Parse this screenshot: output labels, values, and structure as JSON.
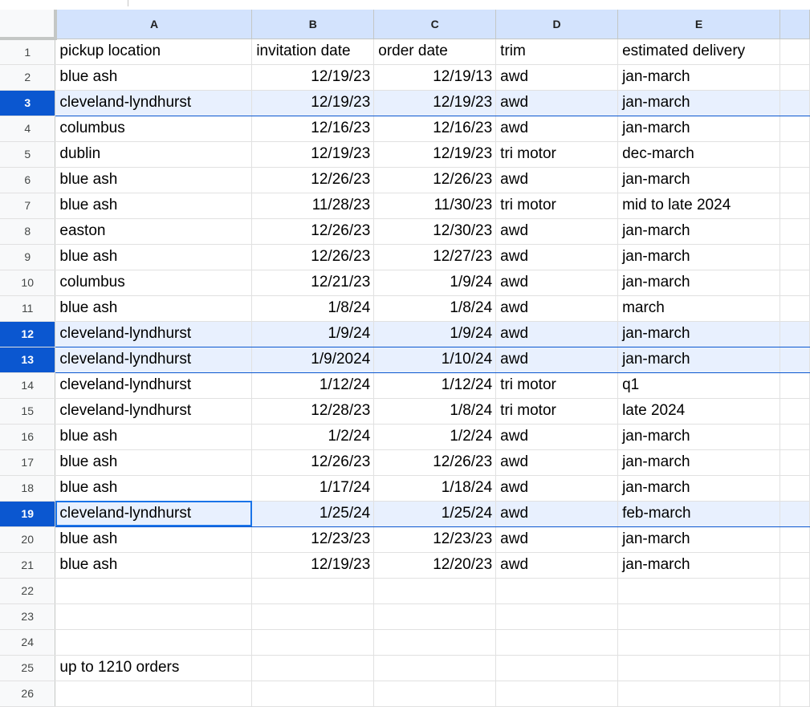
{
  "columns": [
    "A",
    "B",
    "C",
    "D",
    "E"
  ],
  "rows": [
    {
      "n": "1",
      "cells": [
        "pickup location",
        "invitation date",
        "order date",
        "trim",
        "estimated delivery"
      ]
    },
    {
      "n": "2",
      "cells": [
        "blue ash",
        "12/19/23",
        "12/19/13",
        "awd",
        "jan-march"
      ]
    },
    {
      "n": "3",
      "cells": [
        "cleveland-lyndhurst",
        "12/19/23",
        "12/19/23",
        "awd",
        "jan-march"
      ]
    },
    {
      "n": "4",
      "cells": [
        "columbus",
        "12/16/23",
        "12/16/23",
        "awd",
        "jan-march"
      ]
    },
    {
      "n": "5",
      "cells": [
        "dublin",
        "12/19/23",
        "12/19/23",
        "tri motor",
        "dec-march"
      ]
    },
    {
      "n": "6",
      "cells": [
        "blue ash",
        "12/26/23",
        "12/26/23",
        "awd",
        "jan-march"
      ]
    },
    {
      "n": "7",
      "cells": [
        "blue ash",
        "11/28/23",
        "11/30/23",
        "tri motor",
        "mid to late 2024"
      ]
    },
    {
      "n": "8",
      "cells": [
        "easton",
        "12/26/23",
        "12/30/23",
        "awd",
        "jan-march"
      ]
    },
    {
      "n": "9",
      "cells": [
        "blue ash",
        "12/26/23",
        "12/27/23",
        "awd",
        "jan-march"
      ]
    },
    {
      "n": "10",
      "cells": [
        "columbus",
        "12/21/23",
        "1/9/24",
        "awd",
        "jan-march"
      ]
    },
    {
      "n": "11",
      "cells": [
        "blue ash",
        "1/8/24",
        "1/8/24",
        "awd",
        "march"
      ]
    },
    {
      "n": "12",
      "cells": [
        "cleveland-lyndhurst",
        "1/9/24",
        "1/9/24",
        "awd",
        "jan-march"
      ]
    },
    {
      "n": "13",
      "cells": [
        "cleveland-lyndhurst",
        "1/9/2024",
        "1/10/24",
        "awd",
        "jan-march"
      ]
    },
    {
      "n": "14",
      "cells": [
        "cleveland-lyndhurst",
        "1/12/24",
        "1/12/24",
        "tri motor",
        "q1"
      ]
    },
    {
      "n": "15",
      "cells": [
        "cleveland-lyndhurst",
        "12/28/23",
        "1/8/24",
        "tri motor",
        "late 2024"
      ]
    },
    {
      "n": "16",
      "cells": [
        "blue ash",
        "1/2/24",
        "1/2/24",
        "awd",
        "jan-march"
      ]
    },
    {
      "n": "17",
      "cells": [
        "blue ash",
        "12/26/23",
        "12/26/23",
        "awd",
        "jan-march"
      ]
    },
    {
      "n": "18",
      "cells": [
        "blue ash",
        "1/17/24",
        "1/18/24",
        "awd",
        "jan-march"
      ]
    },
    {
      "n": "19",
      "cells": [
        "cleveland-lyndhurst",
        "1/25/24",
        "1/25/24",
        "awd",
        "feb-march"
      ]
    },
    {
      "n": "20",
      "cells": [
        "blue ash",
        "12/23/23",
        "12/23/23",
        "awd",
        "jan-march"
      ]
    },
    {
      "n": "21",
      "cells": [
        "blue ash",
        "12/19/23",
        "12/20/23",
        "awd",
        "jan-march"
      ]
    },
    {
      "n": "22",
      "cells": [
        "",
        "",
        "",
        "",
        ""
      ]
    },
    {
      "n": "23",
      "cells": [
        "",
        "",
        "",
        "",
        ""
      ]
    },
    {
      "n": "24",
      "cells": [
        "",
        "",
        "",
        "",
        ""
      ]
    },
    {
      "n": "25",
      "cells": [
        "up to 1210 orders",
        "",
        "",
        "",
        ""
      ]
    },
    {
      "n": "26",
      "cells": [
        "",
        "",
        "",
        "",
        ""
      ]
    }
  ],
  "selected_rows": [
    "3",
    "12",
    "13",
    "19"
  ],
  "active_cell": "A19",
  "colors": {
    "header_bg": "#d3e3fd",
    "selected_row_header": "#0b57d0",
    "selected_row_fill": "#e8f0fe",
    "active_cell_border": "#1a73e8"
  }
}
